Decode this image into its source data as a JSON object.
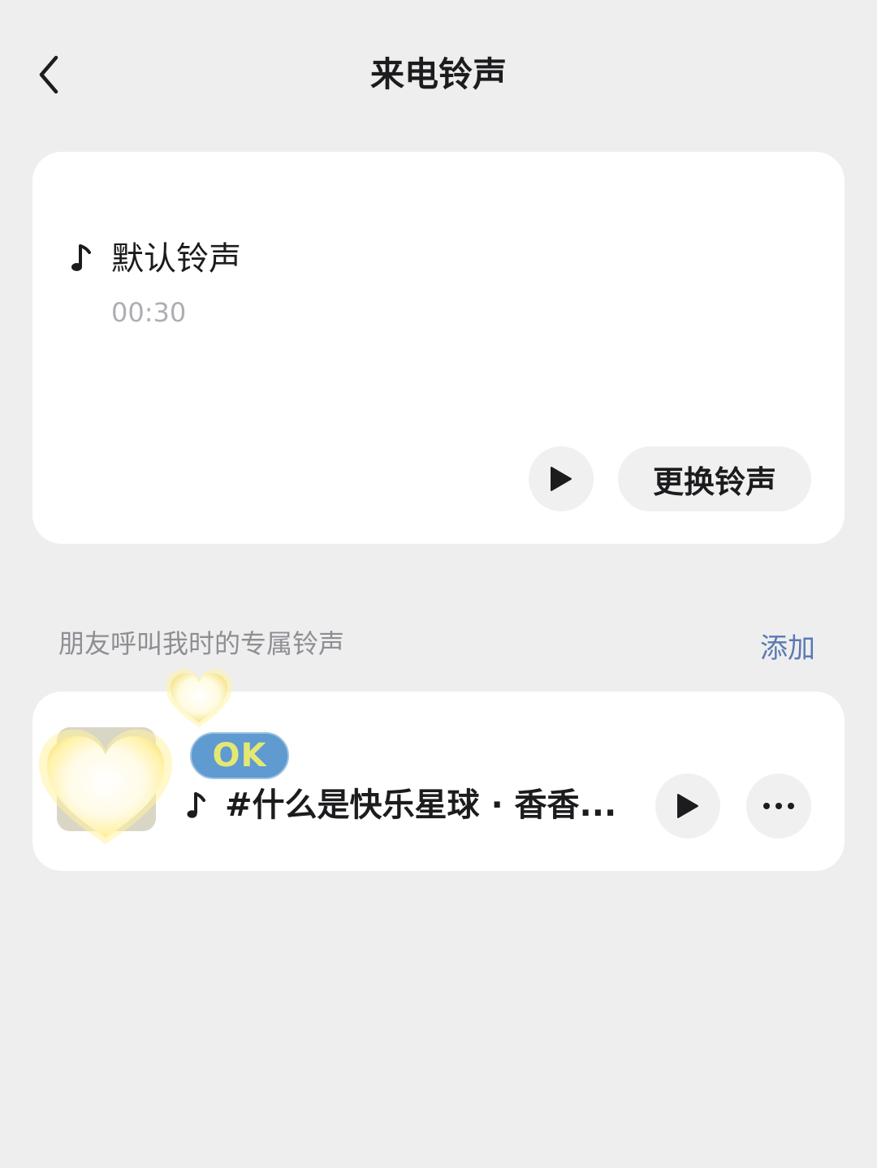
{
  "nav": {
    "title": "来电铃声"
  },
  "default_ringtone": {
    "name": "默认铃声",
    "duration": "00:30",
    "change_label": "更换铃声"
  },
  "friends_section": {
    "title": "朋友呼叫我时的专属铃声",
    "add_label": "添加",
    "items": [
      {
        "badge": "OK",
        "name": "#什么是快乐星球 · 香香..."
      }
    ]
  },
  "colors": {
    "background": "#eeeeef",
    "card": "#ffffff",
    "link": "#5b79b3",
    "secondary_text": "#8e8e93"
  }
}
